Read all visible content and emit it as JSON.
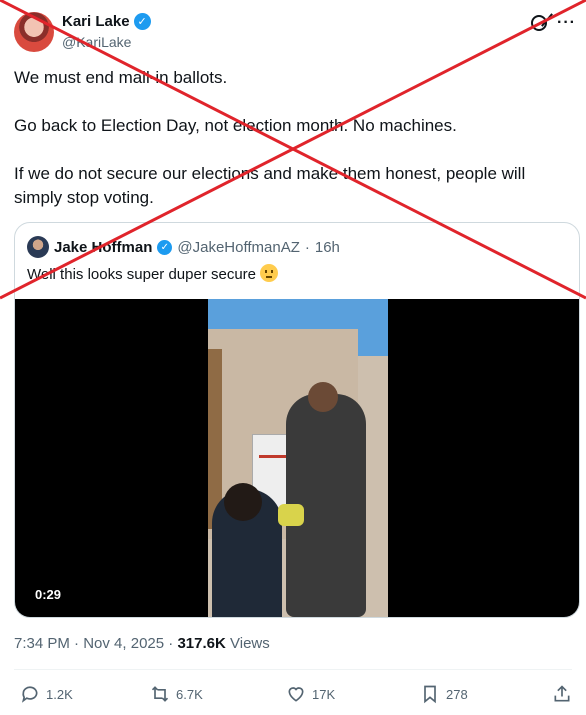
{
  "author": {
    "name": "Kari Lake",
    "verified_mark": "✓",
    "handle": "@KariLake"
  },
  "header_icons": [
    "grok-icon",
    "more-icon"
  ],
  "more_label": "···",
  "tweet": {
    "paragraphs": [
      "We must end mail-in ballots.",
      "Go back to Election Day, not election month. No machines.",
      "If we do not secure our elections and make them honest, people will simply stop voting."
    ]
  },
  "quote": {
    "name": "Jake Hoffman",
    "verified_mark": "✓",
    "handle": "@JakeHoffmanAZ",
    "separator": "·",
    "time": "16h",
    "text": "Well this looks super duper secure",
    "emoji": "slightly-frowning-face",
    "video": {
      "duration": "0:29"
    }
  },
  "meta": {
    "time": "7:34 PM",
    "separator": "·",
    "date": "Nov 4, 2025",
    "views_count": "317.6K",
    "views_label": "Views"
  },
  "actions": {
    "replies": "1.2K",
    "reposts": "6.7K",
    "likes": "17K",
    "bookmarks": "278"
  },
  "colors": {
    "accent": "#1d9bf0",
    "text": "#0f1419",
    "secondary": "#536471",
    "border": "#cfd9de",
    "overlay_x": "#e0242b"
  }
}
